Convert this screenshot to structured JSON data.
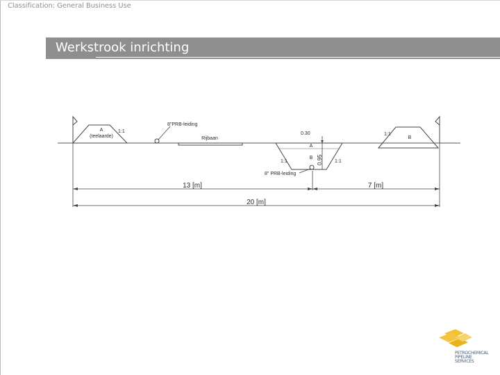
{
  "classification": "Classification: General Business Use",
  "title": "Werkstrook inrichting",
  "diagram": {
    "left_mound_label": "A",
    "left_mound_sublabel": "(teelaarde)",
    "slope_label": "1:1",
    "prb_pipe_label": "8\"PRB-leiding",
    "road_label": "Rijbaan",
    "trench_dim_top": "0.30",
    "trench_dim_depth": "0.95",
    "trench_layer_a": "A",
    "trench_layer_b": "B",
    "trench_pipe_label": "8\" PRB-leiding",
    "right_mound_label": "B",
    "dim_left": "13 [m]",
    "dim_right": "7 [m]",
    "dim_total": "20 [m]"
  },
  "logo_text": [
    "PETROCHEMICAL",
    "PIPELINE",
    "SERVICES"
  ]
}
